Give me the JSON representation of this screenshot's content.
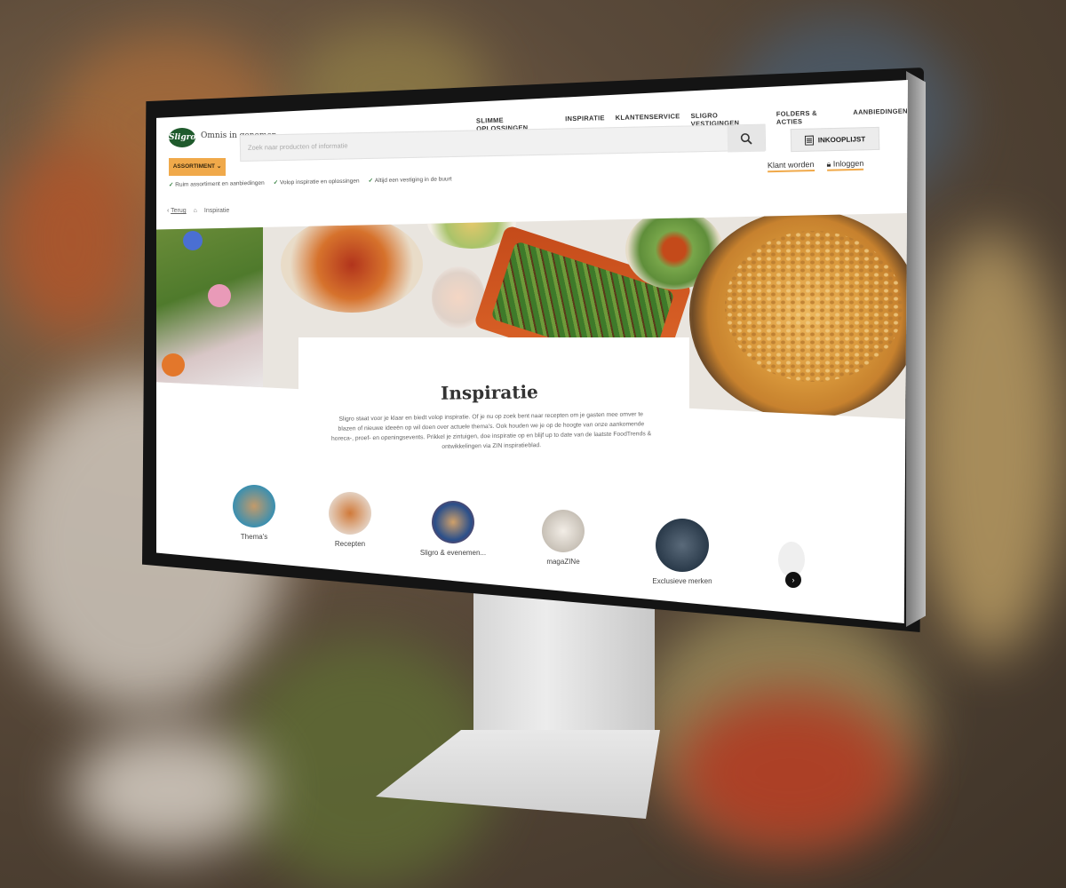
{
  "header": {
    "logo_text": "Sligro",
    "tagline": "Omnis in genomen",
    "top_nav": [
      "SLIMME OPLOSSINGEN",
      "INSPIRATIE",
      "KLANTENSERVICE",
      "SLIGRO VESTIGINGEN",
      "FOLDERS & ACTIES",
      "AANBIEDINGEN"
    ],
    "assortiment_label": "ASSORTIMENT",
    "search_placeholder": "Zoek naar producten of informatie",
    "shopping_list_label": "INKOOPLIJST",
    "become_customer_label": "Klant worden",
    "login_label": "Inloggen",
    "usps": [
      "Ruim assortiment en aanbiedingen",
      "Volop inspiratie en oplossingen",
      "Altijd een vestiging in de buurt"
    ]
  },
  "breadcrumb": {
    "back_label": "Terug",
    "current": "Inspiratie"
  },
  "hero": {
    "title": "Inspiratie",
    "intro": "Sligro staat voor je klaar en biedt volop inspiratie. Of je nu op zoek bent naar recepten om je gasten mee omver te blazen of nieuwe ideeën op wil doen over actuele thema's. Ook houden we je op de hoogte van onze aankomende horeca-, proef- en openingsevents. Prikkel je zintuigen, doe inspiratie op en blijf up to date van de laatste FoodTrends & ontwikkelingen via ZIN inspiratieblad."
  },
  "categories": [
    {
      "label": "Thema's"
    },
    {
      "label": "Recepten"
    },
    {
      "label": "Sligro & evenemen..."
    },
    {
      "label": "magaZINe"
    },
    {
      "label": "Exclusieve merken"
    }
  ],
  "colors": {
    "accent": "#f0a94a",
    "brand_green": "#1f5a2c",
    "check_green": "#2f7d3a"
  }
}
